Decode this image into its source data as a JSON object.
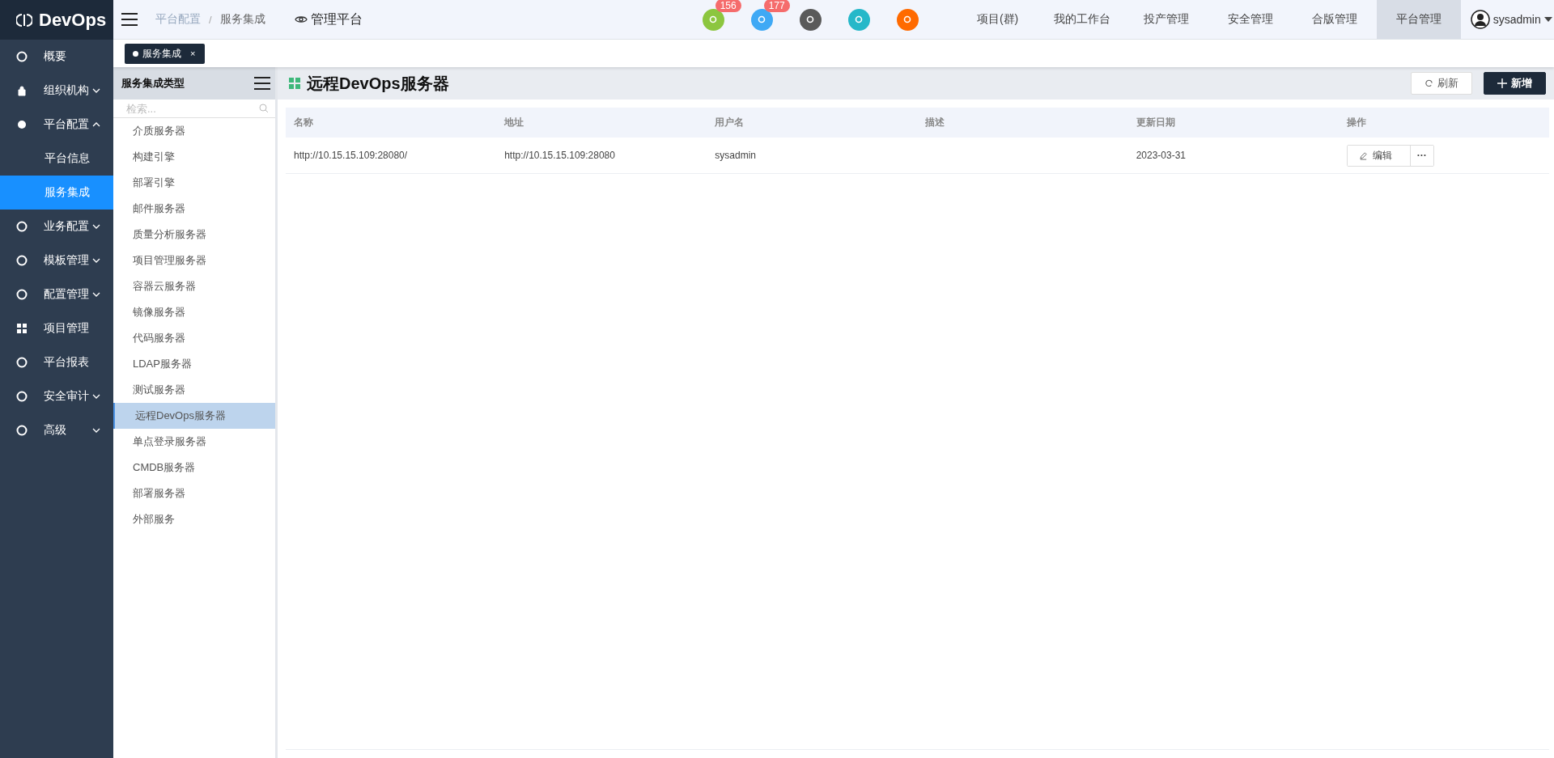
{
  "brand": "DevOps",
  "breadcrumb": [
    "平台配置",
    "服务集成"
  ],
  "breadcrumb_separator": "/",
  "platform_link": "管理平台",
  "header_icons": [
    {
      "badge": "156",
      "color": "#8cc63f"
    },
    {
      "badge": "177",
      "color": "#3fa9f5"
    },
    {
      "color": "#5a5a5a"
    },
    {
      "color": "#26b8c9"
    },
    {
      "color": "#ff6a00"
    }
  ],
  "top_nav": [
    {
      "label": "项目(群)",
      "selected": false
    },
    {
      "label": "我的工作台",
      "selected": false
    },
    {
      "label": "投产管理",
      "selected": false
    },
    {
      "label": "安全管理",
      "selected": false
    },
    {
      "label": "合版管理",
      "selected": false
    },
    {
      "label": "平台管理",
      "selected": true
    }
  ],
  "user": "sysadmin",
  "sidebar": {
    "items": [
      {
        "label": "概要"
      },
      {
        "label": "组织机构",
        "expanded": false
      },
      {
        "label": "平台配置",
        "expanded": true,
        "children": [
          {
            "label": "平台信息",
            "selected": false
          },
          {
            "label": "服务集成",
            "selected": true
          }
        ]
      },
      {
        "label": "业务配置",
        "expanded": false
      },
      {
        "label": "模板管理",
        "expanded": false
      },
      {
        "label": "配置管理",
        "expanded": false
      },
      {
        "label": "项目管理"
      },
      {
        "label": "平台报表"
      },
      {
        "label": "安全审计",
        "expanded": false
      },
      {
        "label": "高级",
        "expanded": false
      }
    ]
  },
  "open_tabs": [
    {
      "label": "服务集成",
      "close": "×"
    }
  ],
  "type_panel": {
    "title": "服务集成类型",
    "search": {
      "placeholder": "检索..."
    },
    "items": [
      {
        "label": "介质服务器",
        "selected": false
      },
      {
        "label": "构建引擎",
        "selected": false
      },
      {
        "label": "部署引擎",
        "selected": false
      },
      {
        "label": "邮件服务器",
        "selected": false
      },
      {
        "label": "质量分析服务器",
        "selected": false
      },
      {
        "label": "项目管理服务器",
        "selected": false
      },
      {
        "label": "容器云服务器",
        "selected": false
      },
      {
        "label": "镜像服务器",
        "selected": false
      },
      {
        "label": "代码服务器",
        "selected": false
      },
      {
        "label": "LDAP服务器",
        "selected": false
      },
      {
        "label": "测试服务器",
        "selected": false
      },
      {
        "label": "远程DevOps服务器",
        "selected": true
      },
      {
        "label": "单点登录服务器",
        "selected": false
      },
      {
        "label": "CMDB服务器",
        "selected": false
      },
      {
        "label": "部署服务器",
        "selected": false
      },
      {
        "label": "外部服务",
        "selected": false
      }
    ]
  },
  "content": {
    "title": "远程DevOps服务器",
    "buttons": [
      {
        "kind": "refresh",
        "label": "刷新"
      },
      {
        "kind": "add",
        "label": "新增"
      }
    ],
    "table": {
      "columns": [
        "名称",
        "地址",
        "用户名",
        "描述",
        "更新日期",
        "操作"
      ],
      "rows": [
        {
          "cells": [
            "http://10.15.15.109:28080/",
            "http://10.15.15.109:28080",
            "sysadmin",
            "",
            "2023-03-31"
          ],
          "edit": "编辑",
          "more": "···"
        }
      ]
    }
  }
}
